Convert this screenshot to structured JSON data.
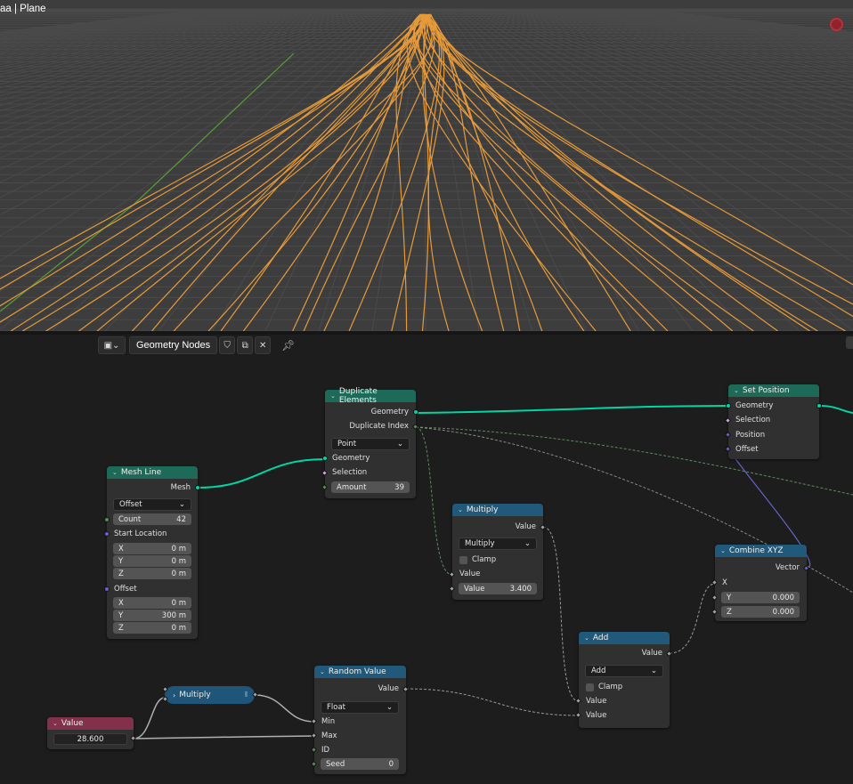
{
  "viewport": {
    "title": "aa | Plane",
    "record_icon": "record-circle-icon",
    "colors": {
      "background": "#3d3d3d",
      "curves": "#e69a3a",
      "grid": "#4a4a4a",
      "axis_y": "#5a9e3a"
    }
  },
  "header": {
    "editor_type_icon": "node-editor-icon",
    "tree_name": "Geometry Nodes",
    "shield_icon": "fake-user-shield-icon",
    "duplicate_icon": "duplicate-icon",
    "close_icon": "close-icon",
    "pin_icon": "pin-icon"
  },
  "nodes": {
    "mesh_line": {
      "title": "Mesh Line",
      "out_mesh": "Mesh",
      "mode": "Offset",
      "count_label": "Count",
      "count_value": "42",
      "start_location": "Start Location",
      "start": {
        "x_label": "X",
        "x": "0 m",
        "y_label": "Y",
        "y": "0 m",
        "z_label": "Z",
        "z": "0 m"
      },
      "offset_label": "Offset",
      "offset": {
        "x_label": "X",
        "x": "0 m",
        "y_label": "Y",
        "y": "300 m",
        "z_label": "Z",
        "z": "0 m"
      }
    },
    "duplicate": {
      "title": "Duplicate Elements",
      "out_geometry": "Geometry",
      "out_index": "Duplicate Index",
      "domain": "Point",
      "in_geometry": "Geometry",
      "in_selection": "Selection",
      "amount_label": "Amount",
      "amount_value": "39"
    },
    "multiply1": {
      "title": "Multiply",
      "out_value": "Value",
      "operation": "Multiply",
      "clamp": "Clamp",
      "in_value": "Value",
      "value_label": "Value",
      "value_value": "3.400"
    },
    "set_position": {
      "title": "Set Position",
      "out_geometry": "Geometry",
      "in_selection": "Selection",
      "in_position": "Position",
      "in_offset": "Offset"
    },
    "combine_xyz": {
      "title": "Combine XYZ",
      "out_vector": "Vector",
      "in_x": "X",
      "y_label": "Y",
      "y_value": "0.000",
      "z_label": "Z",
      "z_value": "0.000"
    },
    "add": {
      "title": "Add",
      "out_value": "Value",
      "operation": "Add",
      "clamp": "Clamp",
      "in_value1": "Value",
      "in_value2": "Value"
    },
    "random_value": {
      "title": "Random Value",
      "out_value": "Value",
      "data_type": "Float",
      "in_min": "Min",
      "in_max": "Max",
      "in_id": "ID",
      "seed_label": "Seed",
      "seed_value": "0"
    },
    "multiply2": {
      "title": "Multiply"
    },
    "value": {
      "title": "Value",
      "value": "28.600"
    }
  },
  "colors": {
    "geometry_socket": "#00d6a3",
    "float_socket": "#a1a1a1",
    "vector_socket": "#6363c7",
    "geometry_header": "#1e6a59",
    "converter_header": "#21597a",
    "input_header": "#83314a"
  }
}
